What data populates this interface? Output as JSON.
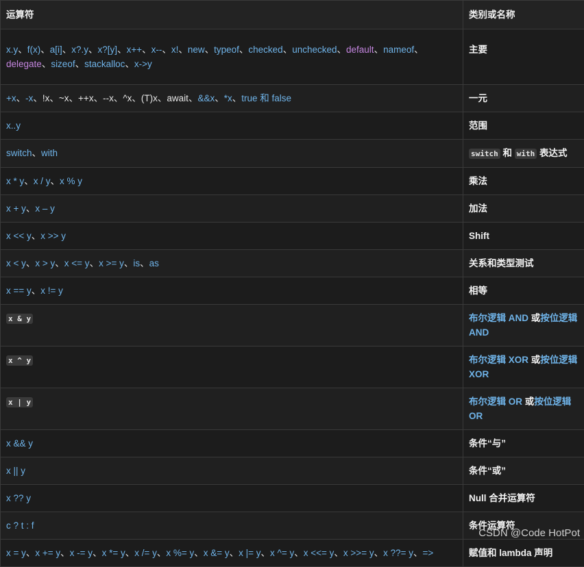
{
  "headers": {
    "col_operators": "运算符",
    "col_category": "类别或名称"
  },
  "rows": [
    {
      "name": "primary",
      "pad": 19,
      "segs_ops": [
        {
          "t": "x.y",
          "k": "link"
        },
        {
          "t": "、",
          "k": "sep"
        },
        {
          "t": "f(x)",
          "k": "link"
        },
        {
          "t": "、",
          "k": "sep"
        },
        {
          "t": "a[i]",
          "k": "link"
        },
        {
          "t": "、",
          "k": "sep"
        },
        {
          "t": "x?.y",
          "k": "link"
        },
        {
          "t": "、",
          "k": "sep"
        },
        {
          "t": "x?[y]",
          "k": "link"
        },
        {
          "t": "、",
          "k": "sep"
        },
        {
          "t": "x++",
          "k": "link"
        },
        {
          "t": "、",
          "k": "sep"
        },
        {
          "t": "x--",
          "k": "link"
        },
        {
          "t": "、",
          "k": "sep"
        },
        {
          "t": "x!",
          "k": "link"
        },
        {
          "t": "、",
          "k": "sep"
        },
        {
          "t": "new",
          "k": "link"
        },
        {
          "t": "、",
          "k": "sep"
        },
        {
          "t": "typeof",
          "k": "link"
        },
        {
          "t": "、",
          "k": "sep"
        },
        {
          "t": "checked",
          "k": "link"
        },
        {
          "t": "、",
          "k": "sep"
        },
        {
          "t": "unchecked",
          "k": "link"
        },
        {
          "t": "、",
          "k": "sep"
        },
        {
          "t": "default",
          "k": "kw"
        },
        {
          "t": "、",
          "k": "sep"
        },
        {
          "t": "nameof",
          "k": "link"
        },
        {
          "t": "、",
          "k": "sep"
        },
        {
          "t": "delegate",
          "k": "kw"
        },
        {
          "t": "、",
          "k": "sep"
        },
        {
          "t": "sizeof",
          "k": "link"
        },
        {
          "t": "、",
          "k": "sep"
        },
        {
          "t": "stackalloc",
          "k": "link"
        },
        {
          "t": "、",
          "k": "sep"
        },
        {
          "t": "x->y",
          "k": "link"
        }
      ],
      "segs_cat": [
        {
          "t": "主要",
          "k": "bold"
        }
      ]
    },
    {
      "name": "unary",
      "pad": 9,
      "segs_ops": [
        {
          "t": "+x",
          "k": "link"
        },
        {
          "t": "、",
          "k": "sep"
        },
        {
          "t": "-x",
          "k": "link"
        },
        {
          "t": "、",
          "k": "sep"
        },
        {
          "t": "!x",
          "k": "plain"
        },
        {
          "t": "、",
          "k": "sep"
        },
        {
          "t": "~x",
          "k": "plain"
        },
        {
          "t": "、",
          "k": "sep"
        },
        {
          "t": "++x",
          "k": "plain"
        },
        {
          "t": "、",
          "k": "sep"
        },
        {
          "t": "--x",
          "k": "plain"
        },
        {
          "t": "、",
          "k": "sep"
        },
        {
          "t": "^x",
          "k": "plain"
        },
        {
          "t": "、",
          "k": "sep"
        },
        {
          "t": "(T)x",
          "k": "plain"
        },
        {
          "t": "、",
          "k": "sep"
        },
        {
          "t": "await",
          "k": "plain"
        },
        {
          "t": "、",
          "k": "sep"
        },
        {
          "t": "&&x",
          "k": "link"
        },
        {
          "t": "、",
          "k": "sep"
        },
        {
          "t": "*x",
          "k": "link"
        },
        {
          "t": "、",
          "k": "sep"
        },
        {
          "t": "true 和 false",
          "k": "link"
        }
      ],
      "segs_cat": [
        {
          "t": "一元",
          "k": "bold"
        }
      ]
    },
    {
      "name": "range",
      "pad": 9,
      "segs_ops": [
        {
          "t": "x..y",
          "k": "link"
        }
      ],
      "segs_cat": [
        {
          "t": "范围",
          "k": "bold"
        }
      ]
    },
    {
      "name": "switch-with",
      "pad": 9,
      "segs_ops": [
        {
          "t": "switch",
          "k": "link"
        },
        {
          "t": "、",
          "k": "sep"
        },
        {
          "t": "with",
          "k": "link"
        }
      ],
      "segs_cat": [
        {
          "t": "switch",
          "k": "code"
        },
        {
          "t": " 和 ",
          "k": "bold"
        },
        {
          "t": "with",
          "k": "code"
        },
        {
          "t": " 表达式",
          "k": "bold"
        }
      ]
    },
    {
      "name": "multiplicative",
      "pad": 9,
      "segs_ops": [
        {
          "t": "x * y",
          "k": "link"
        },
        {
          "t": "、",
          "k": "sep"
        },
        {
          "t": "x / y",
          "k": "link"
        },
        {
          "t": "、",
          "k": "sep"
        },
        {
          "t": "x % y",
          "k": "link"
        }
      ],
      "segs_cat": [
        {
          "t": "乘法",
          "k": "bold"
        }
      ]
    },
    {
      "name": "additive",
      "pad": 9,
      "segs_ops": [
        {
          "t": "x + y",
          "k": "link"
        },
        {
          "t": "、",
          "k": "sep"
        },
        {
          "t": "x – y",
          "k": "link"
        }
      ],
      "segs_cat": [
        {
          "t": "加法",
          "k": "bold"
        }
      ]
    },
    {
      "name": "shift",
      "pad": 9,
      "segs_ops": [
        {
          "t": "x << y",
          "k": "link"
        },
        {
          "t": "、",
          "k": "sep"
        },
        {
          "t": "x >> y",
          "k": "link"
        }
      ],
      "segs_cat": [
        {
          "t": "Shift",
          "k": "bold"
        }
      ]
    },
    {
      "name": "relational",
      "pad": 9,
      "segs_ops": [
        {
          "t": "x < y",
          "k": "link"
        },
        {
          "t": "、",
          "k": "sep"
        },
        {
          "t": "x > y",
          "k": "link"
        },
        {
          "t": "、",
          "k": "sep"
        },
        {
          "t": "x <= y",
          "k": "link"
        },
        {
          "t": "、",
          "k": "sep"
        },
        {
          "t": "x >= y",
          "k": "link"
        },
        {
          "t": "、",
          "k": "sep"
        },
        {
          "t": "is",
          "k": "link"
        },
        {
          "t": "、",
          "k": "sep"
        },
        {
          "t": "as",
          "k": "link"
        }
      ],
      "segs_cat": [
        {
          "t": "关系和类型测试",
          "k": "bold"
        }
      ]
    },
    {
      "name": "equality",
      "pad": 9,
      "segs_ops": [
        {
          "t": "x == y",
          "k": "link"
        },
        {
          "t": "、",
          "k": "sep"
        },
        {
          "t": "x != y",
          "k": "link"
        }
      ],
      "segs_cat": [
        {
          "t": "相等",
          "k": "bold"
        }
      ]
    },
    {
      "name": "logical-and",
      "pad": 9,
      "segs_ops": [
        {
          "t": "x & y",
          "k": "code"
        }
      ],
      "segs_cat": [
        {
          "t": "布尔逻辑 AND",
          "k": "link"
        },
        {
          "t": " 或",
          "k": "bold"
        },
        {
          "t": "按位逻辑 AND",
          "k": "link"
        }
      ]
    },
    {
      "name": "logical-xor",
      "pad": 9,
      "segs_ops": [
        {
          "t": "x ^ y",
          "k": "code"
        }
      ],
      "segs_cat": [
        {
          "t": "布尔逻辑 XOR",
          "k": "link"
        },
        {
          "t": " 或",
          "k": "bold"
        },
        {
          "t": "按位逻辑 XOR",
          "k": "link"
        }
      ]
    },
    {
      "name": "logical-or",
      "pad": 9,
      "segs_ops": [
        {
          "t": "x | y",
          "k": "code"
        }
      ],
      "segs_cat": [
        {
          "t": "布尔逻辑 OR",
          "k": "link"
        },
        {
          "t": " 或",
          "k": "bold"
        },
        {
          "t": "按位逻辑 OR",
          "k": "link"
        }
      ]
    },
    {
      "name": "conditional-and",
      "pad": 9,
      "segs_ops": [
        {
          "t": "x && y",
          "k": "link"
        }
      ],
      "segs_cat": [
        {
          "t": "条件“与”",
          "k": "bold"
        }
      ]
    },
    {
      "name": "conditional-or",
      "pad": 9,
      "segs_ops": [
        {
          "t": "x || y",
          "k": "link"
        }
      ],
      "segs_cat": [
        {
          "t": "条件“或”",
          "k": "bold"
        }
      ]
    },
    {
      "name": "null-coalescing",
      "pad": 9,
      "segs_ops": [
        {
          "t": "x ?? y",
          "k": "link"
        }
      ],
      "segs_cat": [
        {
          "t": "Null 合并运算符",
          "k": "bold"
        }
      ]
    },
    {
      "name": "conditional",
      "pad": 9,
      "segs_ops": [
        {
          "t": "c ? t : f",
          "k": "link"
        }
      ],
      "segs_cat": [
        {
          "t": "条件运算符",
          "k": "bold"
        }
      ]
    },
    {
      "name": "assignment",
      "pad": 9,
      "segs_ops": [
        {
          "t": "x = y",
          "k": "link"
        },
        {
          "t": "、",
          "k": "sep"
        },
        {
          "t": "x += y",
          "k": "link"
        },
        {
          "t": "、",
          "k": "sep"
        },
        {
          "t": "x -= y",
          "k": "link"
        },
        {
          "t": "、",
          "k": "sep"
        },
        {
          "t": "x *= y",
          "k": "link"
        },
        {
          "t": "、",
          "k": "sep"
        },
        {
          "t": "x /= y",
          "k": "link"
        },
        {
          "t": "、",
          "k": "sep"
        },
        {
          "t": "x %= y",
          "k": "link"
        },
        {
          "t": "、",
          "k": "sep"
        },
        {
          "t": "x &= y",
          "k": "link"
        },
        {
          "t": "、",
          "k": "sep"
        },
        {
          "t": "x |= y",
          "k": "link"
        },
        {
          "t": "、",
          "k": "sep"
        },
        {
          "t": "x ^= y",
          "k": "link"
        },
        {
          "t": "、",
          "k": "sep"
        },
        {
          "t": "x <<= y",
          "k": "link"
        },
        {
          "t": "、",
          "k": "sep"
        },
        {
          "t": "x >>= y",
          "k": "link"
        },
        {
          "t": "、",
          "k": "sep"
        },
        {
          "t": "x ??= y",
          "k": "link"
        },
        {
          "t": "、",
          "k": "sep"
        },
        {
          "t": "=>",
          "k": "link"
        }
      ],
      "segs_cat": [
        {
          "t": "赋值和 lambda 声明",
          "k": "bold"
        }
      ]
    }
  ],
  "watermark": "CSDN @Code HotPot"
}
